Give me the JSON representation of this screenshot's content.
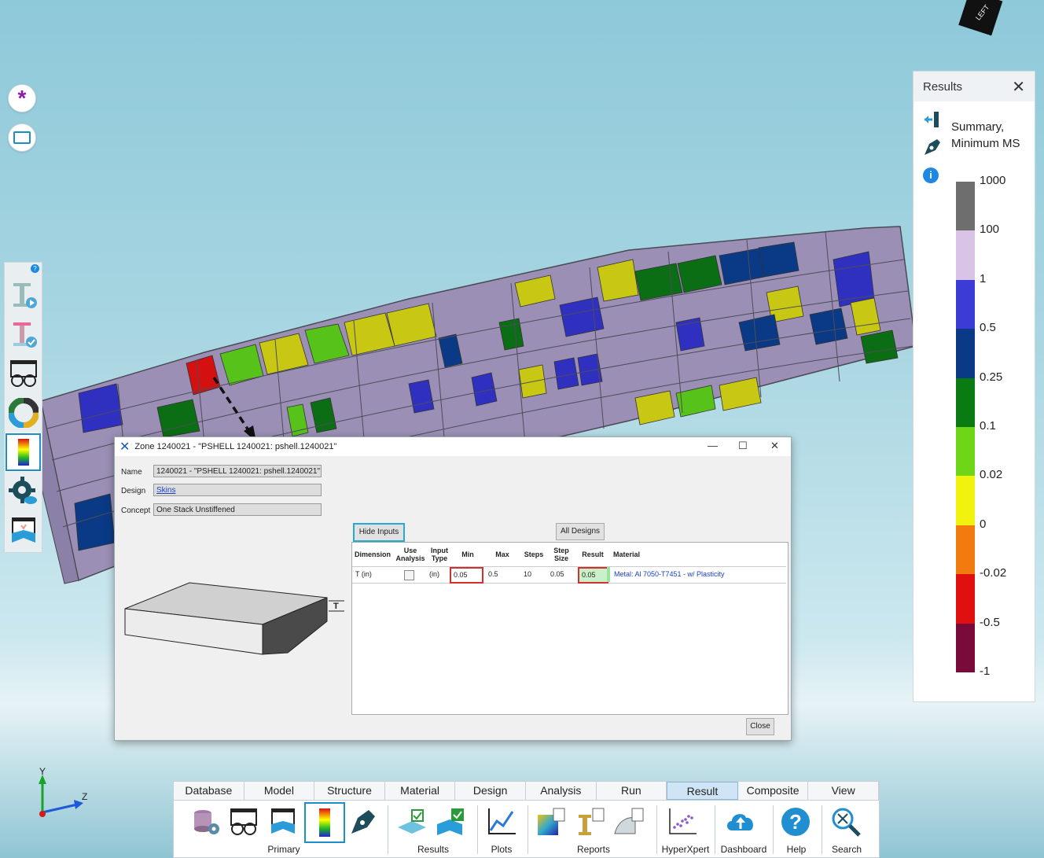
{
  "results_panel": {
    "title": "Results",
    "close_icon": "close-icon",
    "summary_title": "Summary, Minimum MS",
    "legend": {
      "labels": [
        "1000",
        "100",
        "1",
        "0.5",
        "0.25",
        "0.1",
        "0.02",
        "0",
        "-0.02",
        "-0.5",
        "-1"
      ],
      "colors": [
        "#6e6e6e",
        "#d9c4e8",
        "#3b3bd6",
        "#0a3a86",
        "#0a7a12",
        "#6ed616",
        "#f2f20f",
        "#f27b0f",
        "#e01010",
        "#7a0a3a"
      ]
    }
  },
  "dialog": {
    "title": "Zone 1240021 - \"PSHELL 1240021: pshell.1240021\"",
    "name_label": "Name",
    "name_value": "1240021 - \"PSHELL 1240021: pshell.1240021\"",
    "design_label": "Design",
    "design_value": "Skins",
    "concept_label": "Concept",
    "concept_value": "One Stack Unstiffened",
    "hide_inputs": "Hide Inputs",
    "all_designs": "All Designs",
    "thickness_tag": "T",
    "close": "Close",
    "table": {
      "headers": [
        "Dimension",
        "Use Analysis",
        "Input Type",
        "Min",
        "Max",
        "Steps",
        "Step Size",
        "Result",
        "Material"
      ],
      "row": {
        "dimension": "T (in)",
        "input_type": "(in)",
        "min": "0.05",
        "max": "0.5",
        "steps": "10",
        "step_size": "0.05",
        "result": "0.05",
        "material": "Metal: Al 7050-T7451 - w/ Plasticity"
      }
    }
  },
  "ribbon": {
    "tabs": [
      "Database",
      "Model",
      "Structure",
      "Material",
      "Design",
      "Analysis",
      "Run",
      "Result",
      "Composite",
      "View"
    ],
    "active_tab": "Result",
    "groups": [
      "Primary",
      "Results",
      "Plots",
      "Reports",
      "HyperXpert",
      "Dashboard",
      "Help",
      "Search"
    ]
  },
  "axes": {
    "y": "Y",
    "z": "Z"
  },
  "cube_label": "LEFT"
}
